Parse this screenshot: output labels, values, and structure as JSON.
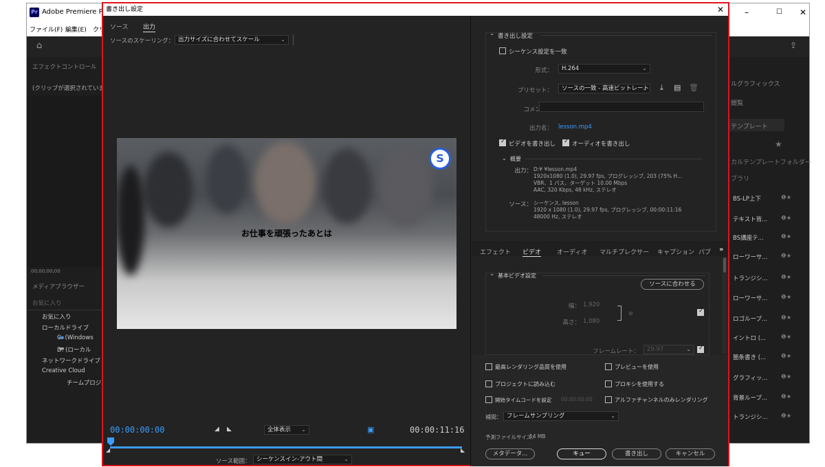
{
  "bg_window": {
    "title": "Adobe Premiere Pro",
    "app_badge": "Pr",
    "menu": [
      "ファイル(F)",
      "編集(E)",
      "クリ"
    ],
    "left_panel": {
      "effect_control": "エフェクトコントロール",
      "no_clip": "(クリップが選択されていま",
      "timecode": "00;00;00;00",
      "media_browser": "メディアブラウザー",
      "favorites_header": "お気に入り",
      "tree": [
        "お気に入り",
        "ローカルドライブ",
        "C: (Windows",
        "D: (ローカル",
        "ネットワークドライブ",
        "Creative Cloud",
        "チームプロジ"
      ]
    },
    "right_panel": {
      "header": "ルグラフィックス",
      "browse": "閲覧",
      "template": "テンプレート",
      "local_folder": "カルテンプレートフォルダー",
      "library": "ブラリ",
      "items": [
        "BS-LP上下",
        "テキスト背...",
        "BS講座テ...",
        "ローワーサ...",
        "トランジシ...",
        "ローワーサ...",
        "ロゴループ...",
        "イントロ (...",
        "箇条書き (...",
        "グラフィッ...",
        "背景ループ...",
        "トランジシ..."
      ]
    }
  },
  "dialog": {
    "title": "書き出し設定",
    "tabs": {
      "source": "ソース",
      "output": "出力"
    },
    "scaling_label": "ソースのスケーリング：",
    "scaling_value": "出力サイズに合わせてスケール",
    "preview_caption": "お仕事を頑張ったあとは",
    "logo_letter": "S",
    "tc_start": "00:00:00:00",
    "tc_end": "00:00:11:16",
    "zoom_value": "全体表示",
    "source_range_label": "ソース範囲：",
    "source_range_value": "シーケンスイン-アウト間",
    "export_settings": {
      "header": "書き出し設定",
      "match_sequence": "シーケンス設定を一致",
      "format_label": "形式：",
      "format_value": "H.264",
      "preset_label": "プリセット：",
      "preset_value": "ソースの一致 - 高速ビットレート",
      "comment_label": "コメント：",
      "output_name_label": "出力名：",
      "output_name_value": "lesson.mp4",
      "export_video": "ビデオを書き出し",
      "export_audio": "オーディオを書き出し",
      "summary_header": "概要",
      "output_label": "出力：",
      "output_lines": [
        "D:¥                                                  ¥lesson.mp4",
        "1920x1080 (1.0), 29.97 fps, プログレッシブ, 203 (75% H...",
        "VBR、1 パス、ターゲット 10.00 Mbps",
        "AAC, 320 Kbps, 48 kHz, ステレオ"
      ],
      "source_label": "ソース：",
      "source_lines": [
        "シーケンス, lesson",
        "1920 x 1080 (1.0), 29.97 fps, プログレッシブ, 00:00:11:16",
        "48000 Hz, ステレオ"
      ]
    },
    "panel_tabs": [
      "エフェクト",
      "ビデオ",
      "オーディオ",
      "マルチプレクサー",
      "キャプション",
      "パブ"
    ],
    "basic_video": {
      "header": "基本ビデオ設定",
      "match_source_btn": "ソースに合わせる",
      "width_label": "幅：",
      "width_value": "1,920",
      "height_label": "高さ：",
      "height_value": "1,080",
      "framerate_label": "フレームレート：",
      "framerate_value": "29.97"
    },
    "options": {
      "max_render": "最高レンダリング品質を使用",
      "use_preview": "プレビューを使用",
      "import_project": "プロジェクトに読み込む",
      "use_proxy": "プロキシを使用する",
      "set_start_tc": "開始タイムコードを設定",
      "start_tc_value": "00:00:00:00",
      "alpha_only": "アルファチャンネルのみレンダリング"
    },
    "interp_label": "補間：",
    "interp_value": "フレームサンプリング",
    "est_size_label": "予測ファイルサイズ：",
    "est_size_value": "14 MB",
    "buttons": {
      "metadata": "メタデータ...",
      "queue": "キュー",
      "export": "書き出し",
      "cancel": "キャンセル"
    }
  }
}
